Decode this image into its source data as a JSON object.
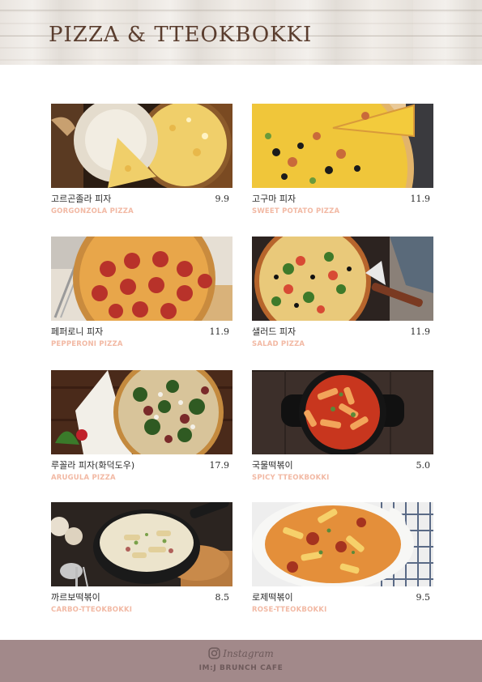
{
  "header": {
    "title": "PIZZA & TTEOKBOKKI"
  },
  "menu": [
    {
      "name": "고르곤졸라 피자",
      "subtitle": "GORGONZOLA  PIZZA",
      "price": "9.9",
      "photo": "gorgonzola-pizza-photo"
    },
    {
      "name": "고구마 피자",
      "subtitle": "SWEET POTATO PIZZA",
      "price": "11.9",
      "photo": "sweet-potato-pizza-photo"
    },
    {
      "name": "페퍼로니 피자",
      "subtitle": "PEPPERONI PIZZA",
      "price": "11.9",
      "photo": "pepperoni-pizza-photo"
    },
    {
      "name": "샐러드 피자",
      "subtitle": "SALAD PIZZA",
      "price": "11.9",
      "photo": "salad-pizza-photo"
    },
    {
      "name": "루꼴라 피자(화덕도우)",
      "subtitle": "ARUGULA  PIZZA",
      "price": "17.9",
      "photo": "arugula-pizza-photo"
    },
    {
      "name": "국물떡볶이",
      "subtitle": "SPICY TTEOKBOKKI",
      "price": "5.0",
      "photo": "spicy-tteokbokki-photo"
    },
    {
      "name": "까르보떡볶이",
      "subtitle": "CARBO-TTEOKBOKKI",
      "price": "8.5",
      "photo": "carbo-tteokbokki-photo"
    },
    {
      "name": "로제떡볶이",
      "subtitle": "ROSE-TTEOKBOKKI",
      "price": "9.5",
      "photo": "rose-tteokbokki-photo"
    }
  ],
  "footer": {
    "instagram_label": "Instagram",
    "instagram_icon": "instagram-icon",
    "cafe_name": "IM:J BRUNCH CAFE"
  },
  "colors": {
    "title": "#5a3d2e",
    "subtitle": "#f2b9a4",
    "footer_bg": "#a2898a",
    "footer_text": "#6e5a5b"
  }
}
